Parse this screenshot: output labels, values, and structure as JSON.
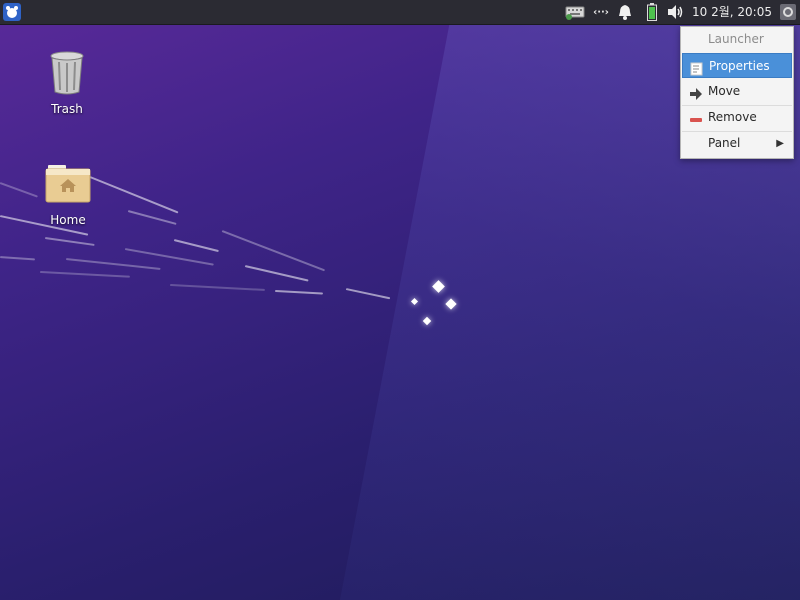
{
  "panel": {
    "clock": "10  2월, 20:05",
    "network_label": "‹··›"
  },
  "desktop": {
    "icons": [
      {
        "label": "Trash"
      },
      {
        "label": "Home"
      }
    ]
  },
  "context_menu": {
    "header": "Launcher",
    "items": [
      {
        "label": "Properties",
        "icon": "properties-icon",
        "selected": true
      },
      {
        "label": "Move",
        "icon": "arrow-right-icon"
      },
      {
        "label": "Remove",
        "icon": "remove-icon"
      },
      {
        "label": "Panel",
        "icon": "submenu-arrow-icon"
      }
    ]
  },
  "colors": {
    "panel_bg": "#2b2b33",
    "menu_highlight": "#4a90d9",
    "battery_green": "#4ec24e",
    "remove_red": "#d9534f"
  }
}
